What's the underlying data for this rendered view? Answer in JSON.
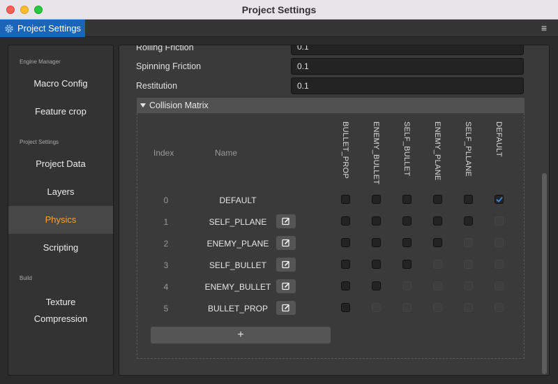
{
  "window": {
    "title": "Project Settings"
  },
  "tab": {
    "label": "Project Settings",
    "icon": "gear-icon"
  },
  "sidebar": {
    "groups": [
      "Engine Manager",
      "Project Settings",
      "Build"
    ],
    "items": [
      {
        "label": "Macro Config"
      },
      {
        "label": "Feature crop"
      },
      {
        "label": "Project Data"
      },
      {
        "label": "Layers"
      },
      {
        "label": "Physics",
        "active": true
      },
      {
        "label": "Scripting"
      },
      {
        "label_line1": "Texture",
        "label_line2": "Compression"
      }
    ]
  },
  "physics": {
    "rows": [
      {
        "label": "Rolling Friction",
        "value": "0.1"
      },
      {
        "label": "Spinning Friction",
        "value": "0.1"
      },
      {
        "label": "Restitution",
        "value": "0.1"
      }
    ]
  },
  "collision_matrix": {
    "title": "Collision Matrix",
    "headers": {
      "index": "Index",
      "name": "Name"
    },
    "columns": [
      "BULLET_PROP",
      "ENEMY_BULLET",
      "SELF_BULLET",
      "ENEMY_PLANE",
      "SELF_PLLANE",
      "DEFAULT"
    ],
    "layers": [
      {
        "index": "0",
        "name": "DEFAULT",
        "editable": false
      },
      {
        "index": "1",
        "name": "SELF_PLLANE",
        "editable": true
      },
      {
        "index": "2",
        "name": "ENEMY_PLANE",
        "editable": true
      },
      {
        "index": "3",
        "name": "SELF_BULLET",
        "editable": true
      },
      {
        "index": "4",
        "name": "ENEMY_BULLET",
        "editable": true
      },
      {
        "index": "5",
        "name": "BULLET_PROP",
        "editable": true
      }
    ],
    "checked": [
      [
        0,
        5
      ]
    ],
    "add_label": "+"
  },
  "colors": {
    "accent": "#f0a640",
    "tab": "#1a65b8",
    "check": "#3b8eea"
  }
}
